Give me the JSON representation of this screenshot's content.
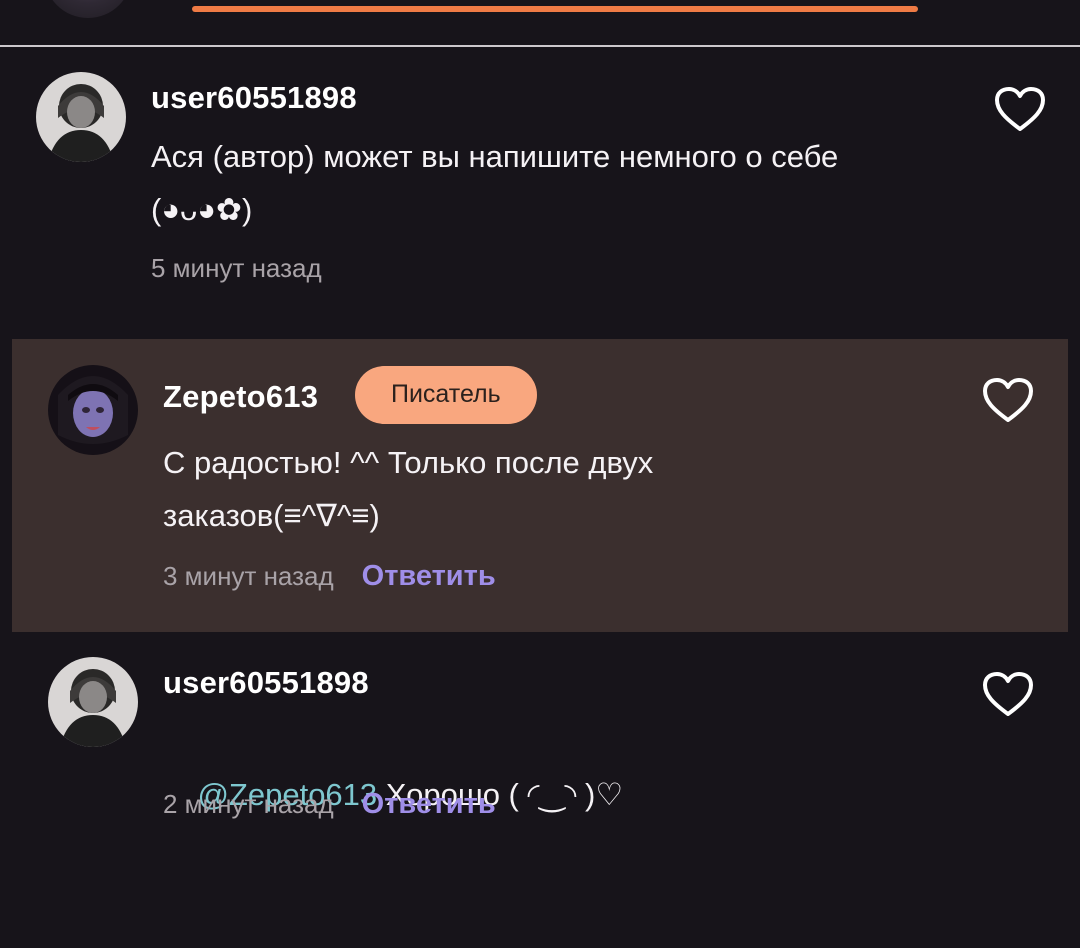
{
  "colors": {
    "background": "#17141a",
    "progress_accent": "#ef7b45",
    "author_highlight_bg": "#3b2f2e",
    "badge_bg": "#f9a77f",
    "reply_link": "#9f8ee8",
    "mention": "#7ec7cf"
  },
  "comments": [
    {
      "username": "user60551898",
      "text": "Ася (автор) может вы напишите немного о себе (◕ᴗ◕✿)",
      "timestamp": "5 минут назад",
      "avatar_icon": "user-avatar-icon",
      "like_icon": "heart-outline-icon"
    },
    {
      "username": "Zepeto613",
      "badge": "Писатель",
      "text": "С радостью! ^^ Только после двух заказов(≡^∇^≡)",
      "timestamp": "3 минут назад",
      "reply": "Ответить",
      "avatar_icon": "writer-avatar-icon",
      "like_icon": "heart-outline-icon"
    },
    {
      "username": "user60551898",
      "mention": "@Zepeto613",
      "text": " Хорошо ( ◜‿◝ )♡",
      "timestamp": "2 минут назад",
      "reply": "Ответить",
      "avatar_icon": "user-avatar-icon",
      "like_icon": "heart-outline-icon"
    }
  ]
}
